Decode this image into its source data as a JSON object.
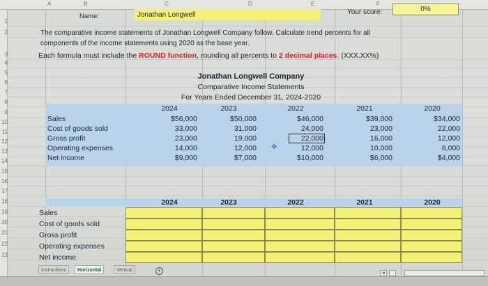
{
  "sheet": {
    "columns": [
      "A",
      "B",
      "C",
      "D",
      "E",
      "F"
    ],
    "rows": [
      "1",
      "2",
      "3",
      "4",
      "5",
      "6",
      "7",
      "8",
      "9",
      "10",
      "11",
      "12",
      "13",
      "14",
      "15",
      "16",
      "17",
      "18",
      "19",
      "20",
      "21",
      "22",
      "23"
    ]
  },
  "header": {
    "name_label": "Name:",
    "name_value": "Jonathan Longwell",
    "score_label": "Your score:",
    "score_value": "0%"
  },
  "instructions": {
    "line1": "The comparative income statements of Jonathan Longwell Company follow. Calculate trend percents for all",
    "line2": "components of the income statements using 2020 as the base year.",
    "line3_prefix": "Each formula must include the",
    "line3_round": "ROUND function",
    "line3_mid": ", rounding all percents to",
    "line3_places": "2 decimal places",
    "line3_suffix": ". (XXX.XX%)"
  },
  "statement": {
    "company": "Jonathan Longwell Company",
    "title": "Comparative Income Statements",
    "period": "For Years Ended December 31, 2024-2020",
    "years": [
      "2024",
      "2023",
      "2022",
      "2021",
      "2020"
    ],
    "rows": [
      {
        "label": "Sales",
        "values": [
          "$56,000",
          "$50,000",
          "$46,000",
          "$39,000",
          "$34,000"
        ]
      },
      {
        "label": "Cost of goods sold",
        "values": [
          "33,000",
          "31,000",
          "24,000",
          "23,000",
          "22,000"
        ]
      },
      {
        "label": "Gross profit",
        "values": [
          "23,000",
          "19,000",
          "22,000",
          "16,000",
          "12,000"
        ]
      },
      {
        "label": "Operating expenses",
        "values": [
          "14,000",
          "12,000",
          "12,000",
          "10,000",
          "8,000"
        ]
      },
      {
        "label": "Net income",
        "values": [
          "$9,000",
          "$7,000",
          "$10,000",
          "$6,000",
          "$4,000"
        ]
      }
    ]
  },
  "trend": {
    "years": [
      "2024",
      "2023",
      "2022",
      "2021",
      "2020"
    ],
    "labels": [
      "Sales",
      "Cost of goods sold",
      "Gross profit",
      "Operating expenses",
      "Net income"
    ]
  },
  "tabs": [
    {
      "label": "Instructions",
      "active": false
    },
    {
      "label": "Horizontal",
      "active": true
    },
    {
      "label": "Vertical",
      "active": false
    }
  ],
  "controls": {
    "add_sheet": "+",
    "scroll_left": "◂"
  },
  "colors": {
    "yellow": "#f4f07a",
    "blue": "#b9d3ea",
    "red": "#c8262a"
  }
}
